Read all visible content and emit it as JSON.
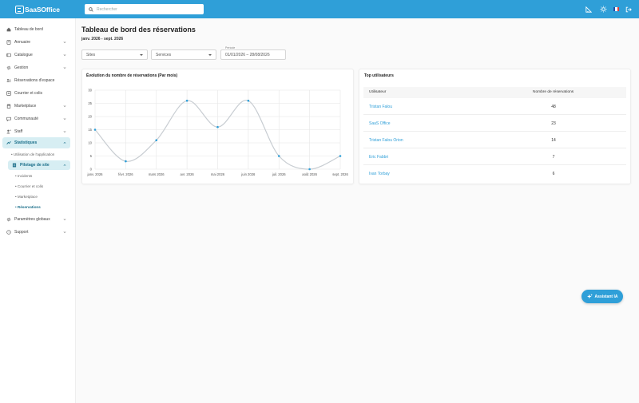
{
  "brand": {
    "name": "SaaSOffice"
  },
  "search": {
    "placeholder": "Rechercher"
  },
  "sidebar": {
    "items": [
      {
        "label": "Tableau de bord",
        "icon": "home-icon"
      },
      {
        "label": "Annuaire",
        "icon": "address-book-icon"
      },
      {
        "label": "Catalogue",
        "icon": "catalog-icon"
      },
      {
        "label": "Gestion",
        "icon": "settings-gear-icon"
      },
      {
        "label": "Réservations d'espace",
        "icon": "people-icon"
      },
      {
        "label": "Courrier et colis",
        "icon": "mail-icon"
      },
      {
        "label": "Marketplace",
        "icon": "store-icon"
      },
      {
        "label": "Communauté",
        "icon": "chat-icon"
      },
      {
        "label": "Staff",
        "icon": "staff-icon"
      },
      {
        "label": "Statistiques",
        "icon": "stats-icon"
      }
    ],
    "stats_sub": {
      "usage": "Utilisation de l'application",
      "pilot": "Pilotage de site"
    },
    "pilot_sub": [
      "Incidents",
      "Courrier et colis",
      "Marketplace",
      "Réservations"
    ],
    "bottom": [
      {
        "label": "Paramètres globaux",
        "icon": "gear-icon"
      },
      {
        "label": "Support",
        "icon": "help-icon"
      }
    ]
  },
  "page": {
    "title": "Tableau de bord des réservations",
    "subtitle": "janv. 2026 - sept. 2026"
  },
  "filters": {
    "sites": "Sites",
    "services": "Services",
    "period_label": "Période",
    "period_value": "01/01/2026 – 28/08/2026"
  },
  "chart_card": {
    "title": "Évolution du nombre de réservations (Par mois)"
  },
  "chart_data": {
    "type": "line",
    "title": "Évolution du nombre de réservations (Par mois)",
    "categories": [
      "janv. 2026",
      "févr. 2026",
      "mars 2026",
      "avr. 2026",
      "mai 2026",
      "juin 2026",
      "juil. 2026",
      "août 2026",
      "sept. 2026"
    ],
    "y_ticks": [
      "0",
      "5",
      "10",
      "15",
      "20",
      "25",
      "30"
    ],
    "ylim": [
      0,
      30
    ],
    "grid": true,
    "series": [
      {
        "values": [
          15,
          3,
          11,
          26,
          16,
          26,
          5,
          0,
          5
        ]
      }
    ],
    "line_color": "#c8cdd2",
    "point_color": "#2f9fd8"
  },
  "top_users": {
    "title": "Top utilisateurs",
    "col_user": "Utilisateur",
    "col_count": "Nombre de réservations",
    "rows": [
      {
        "user": "Tristan Falou",
        "count": "48"
      },
      {
        "user": "SaaS Office",
        "count": "23"
      },
      {
        "user": "Tristan Falou Orion",
        "count": "14"
      },
      {
        "user": "Eric Fabbri",
        "count": "7"
      },
      {
        "user": "Ivan Torbay",
        "count": "6"
      }
    ]
  },
  "assistant": {
    "label": "Assistant IA"
  },
  "colors": {
    "brand": "#2f9fd8",
    "active_bg": "#d7eef3",
    "active_text": "#1b6f8a"
  }
}
